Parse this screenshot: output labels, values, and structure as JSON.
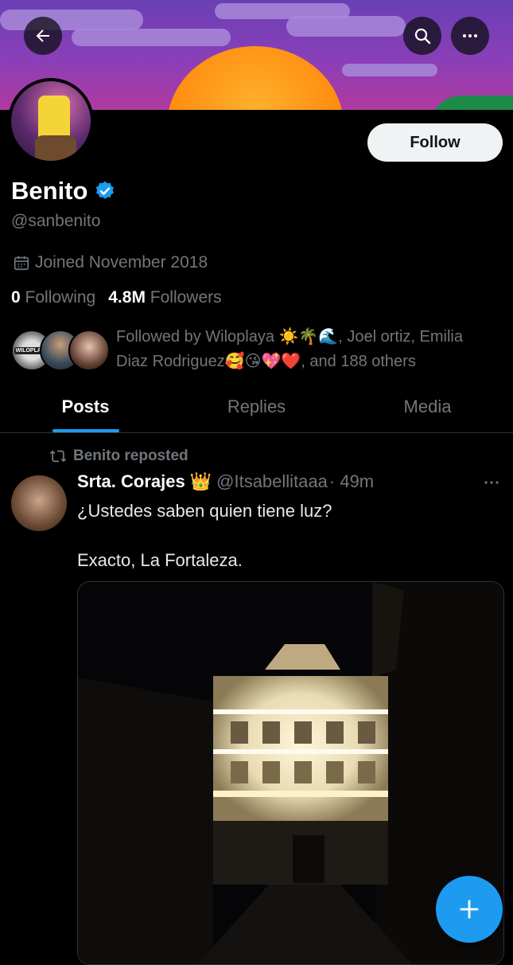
{
  "header": {
    "back_icon": "arrow-left-icon",
    "search_icon": "search-icon",
    "more_icon": "more-horizontal-icon"
  },
  "profile": {
    "name": "Benito",
    "verified": true,
    "handle": "@sanbenito",
    "joined": "Joined November 2018",
    "following_count": "0",
    "following_label": "Following",
    "followers_count": "4.8M",
    "followers_label": "Followers",
    "follow_button": "Follow",
    "followed_by_text": "Followed by Wiloplaya ☀️🌴🌊, Joel ortiz, Emilia Diaz Rodriguez🥰😘💖❤️, and 188 others",
    "followed_avatar_badge": "WILOPLAYA"
  },
  "tabs": [
    {
      "label": "Posts",
      "active": true
    },
    {
      "label": "Replies",
      "active": false
    },
    {
      "label": "Media",
      "active": false
    }
  ],
  "post": {
    "repost_label": "Benito reposted",
    "author_name": "Srta. Corajes",
    "author_emoji": "👑",
    "author_handle": "@Itsabellitaaa",
    "time": "· 49m",
    "text": "¿Ustedes saben quien tiene luz?\n\nExacto, La Fortaleza."
  },
  "colors": {
    "accent": "#1d9bf0",
    "background": "#000000",
    "muted_text": "#71767b"
  }
}
